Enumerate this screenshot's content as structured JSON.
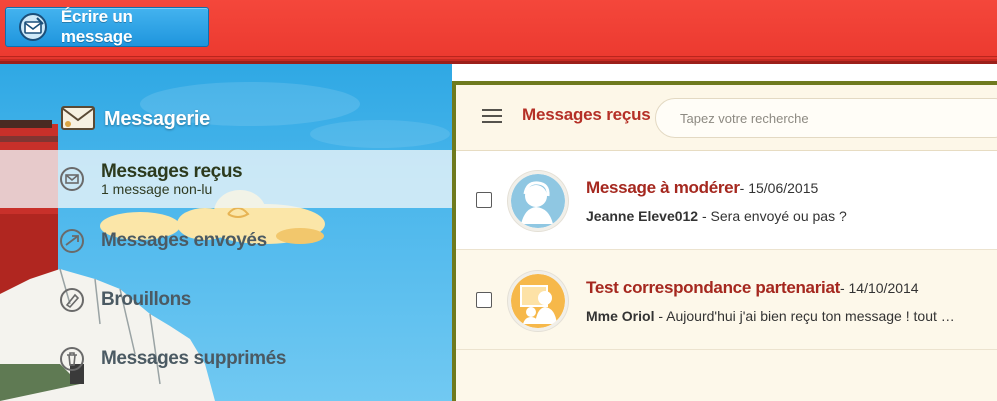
{
  "topbar": {
    "compose_label": "Écrire un message",
    "compose_icon": "compose-mail-icon"
  },
  "sidebar": {
    "title": "Messagerie",
    "title_icon": "envelope-icon",
    "items": [
      {
        "label": "Messages reçus",
        "sub": "1 message non-lu",
        "icon": "inbox-icon",
        "active": true
      },
      {
        "label": "Messages envoyés",
        "sub": "",
        "icon": "send-icon",
        "active": false
      },
      {
        "label": "Brouillons",
        "sub": "",
        "icon": "draft-icon",
        "active": false
      },
      {
        "label": "Messages supprimés",
        "sub": "",
        "icon": "trash-icon",
        "active": false
      }
    ]
  },
  "main": {
    "title": "Messages reçus",
    "menu_icon": "hamburger-icon",
    "search_placeholder": "Tapez votre recherche",
    "messages": [
      {
        "subject": "Message à modérer",
        "date": " - 15/06/2015",
        "sender": "Jeanne Eleve012",
        "preview": " - Sera envoyé ou pas ?",
        "avatar_color": "#8fc7e2"
      },
      {
        "subject": "Test correspondance partenariat",
        "date": " - 14/10/2014",
        "sender": "Mme Oriol",
        "preview": " - Aujourd'hui j'ai bien reçu ton message ! tout …",
        "avatar_color": "#f6b84a"
      }
    ]
  },
  "colors": {
    "topbar": "#ef4137",
    "compose_button": "#2aa3e6",
    "accent_title": "#b53027",
    "panel_border": "#6f7a1e"
  }
}
